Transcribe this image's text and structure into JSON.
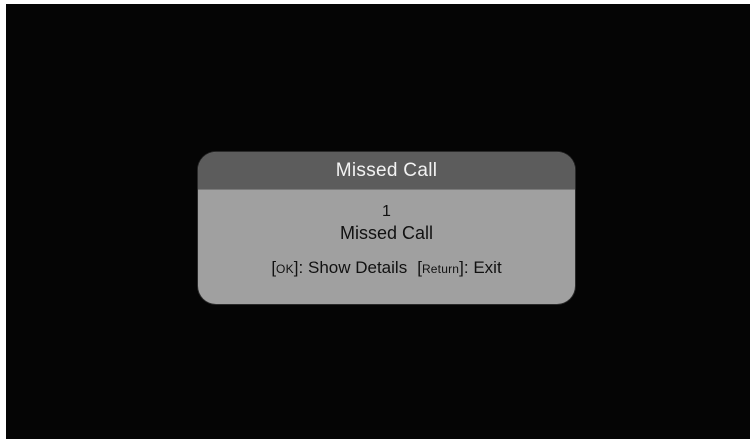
{
  "dialog": {
    "title": "Missed Call",
    "count": "1",
    "message": "Missed Call",
    "hints": [
      {
        "key": "OK",
        "action": ": Show Details"
      },
      {
        "key": "Return",
        "action": ": Exit"
      }
    ]
  },
  "colors": {
    "screen_background": "#050505",
    "dialog_header": "#5c5c5c",
    "dialog_body": "#a0a0a0",
    "title_text": "#f2f2f2",
    "body_text": "#111111"
  }
}
